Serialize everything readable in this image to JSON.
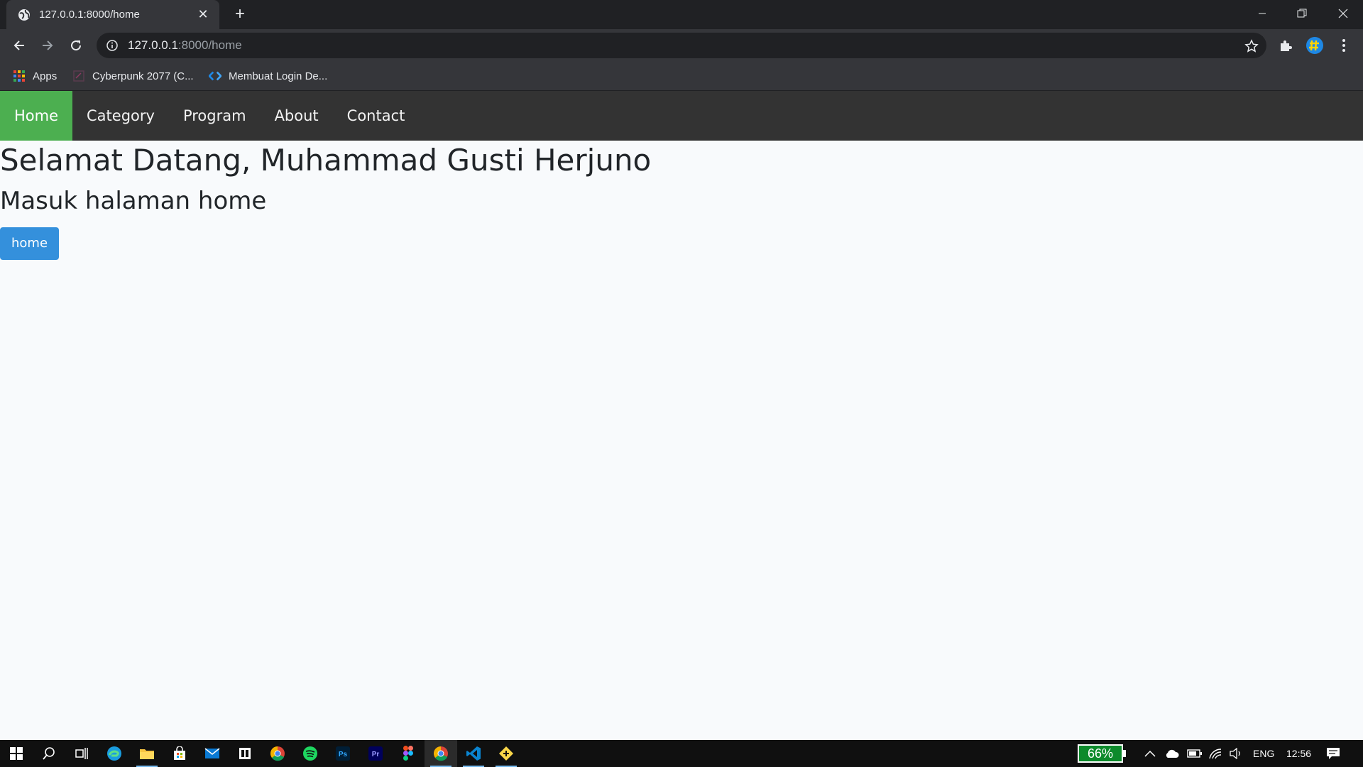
{
  "browser": {
    "tab_title": "127.0.0.1:8000/home",
    "url_host": "127.0.0.1",
    "url_path": ":8000/home",
    "bookmarks": [
      {
        "label": "Apps",
        "icon": "apps-grid-icon"
      },
      {
        "label": "Cyberpunk 2077 (C...",
        "icon": "cyberpunk-favicon"
      },
      {
        "label": "Membuat Login De...",
        "icon": "code-brackets-icon"
      }
    ]
  },
  "site": {
    "nav": [
      {
        "label": "Home",
        "active": true
      },
      {
        "label": "Category",
        "active": false
      },
      {
        "label": "Program",
        "active": false
      },
      {
        "label": "About",
        "active": false
      },
      {
        "label": "Contact",
        "active": false
      }
    ],
    "heading": "Selamat Datang, Muhammad Gusti Herjuno",
    "subheading": "Masuk halaman home",
    "button_label": "home",
    "colors": {
      "nav_bg": "#333333",
      "nav_active": "#4caf50",
      "button": "#3490dc"
    }
  },
  "taskbar": {
    "battery_percent": "66%",
    "language": "ENG",
    "time": "12:56"
  }
}
